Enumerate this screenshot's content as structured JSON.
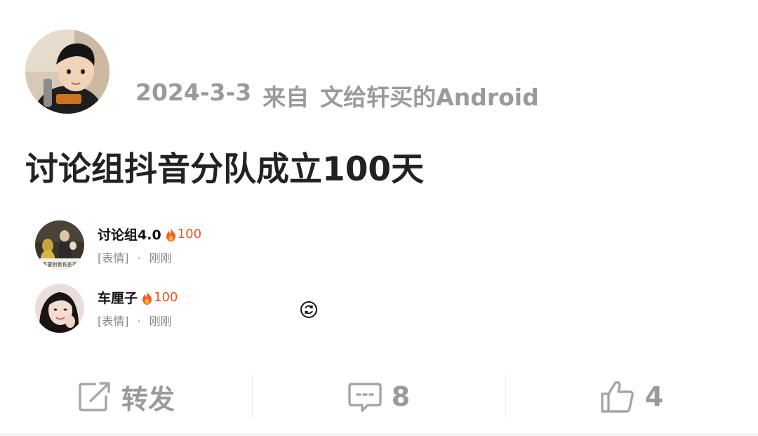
{
  "post": {
    "date": "2024-3-3",
    "source_prefix": "来自",
    "source_device": "文给轩买的Android",
    "title": "讨论组抖音分队成立100天"
  },
  "chats": [
    {
      "name": "讨论组4.0",
      "fire_count": "100",
      "preview": "[表情]",
      "separator": "·",
      "time": "刚刚",
      "avatar_caption": "不要别看有恶意"
    },
    {
      "name": "车厘子",
      "fire_count": "100",
      "preview": "[表情]",
      "separator": "·",
      "time": "刚刚"
    }
  ],
  "actions": {
    "repost_label": "转发",
    "comment_count": "8",
    "like_count": "4"
  },
  "colors": {
    "meta_gray": "#9a9a9a",
    "title": "#222222",
    "fire": "#ff4d1a"
  },
  "icons": [
    "fire-icon",
    "refresh-icon",
    "repost-icon",
    "comment-icon",
    "like-icon"
  ]
}
